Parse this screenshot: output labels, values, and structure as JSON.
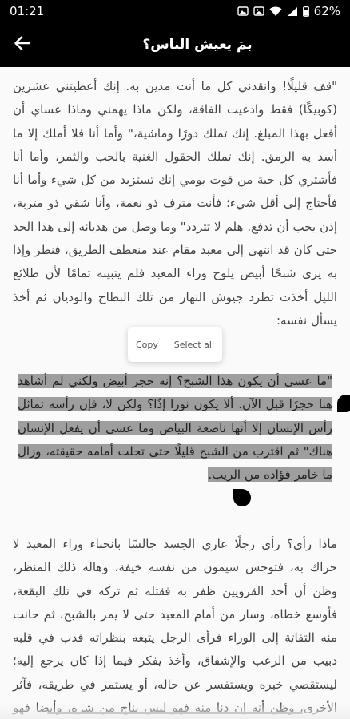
{
  "status": {
    "time": "01:21",
    "battery": "62%",
    "icons": [
      "photo-icon",
      "image-icon",
      "wifi-icon",
      "signal-icon"
    ]
  },
  "appbar": {
    "title": "بمَ يعيش الناس؟",
    "back_icon": "arrow-left-icon"
  },
  "paragraphs": {
    "p1": "\"قف قليلًا! وانقدني كل ما أنت مدين به. إنك أعطيتني عشرين (كوبيكًا) فقط وادعيت الفاقة، ولكن ماذا يهمني وماذا عساي أن أفعل بهذا المبلغ. إنك تملك دورًا وماشية،\" وأما أنا فلا أملك إلا ما أسد به الرمق. إنك تملك الحقول الغنية بالحب والثمر، وأما أنا فأشتري كل حبة من قوت يومي إنك تستزيد من كل شيء وأما أنا فأحتاج إلى أقل شيء؛ فأنت مترف ذو نعمة، وأنا شقي ذو متربة، إذن يجب أن تدفع. هلم لا تتردد\" وما وصل من هذيانه إلى هذا الحد حتى كان قد انتهى إلى معبد مقام عند منعطف الطريق، فنظر وإذا به يرى شبحًا أبيض يلوح وراء المعبد فلم يتبينه تمامًا لأن طلائع الليل أخذت تطرد جيوش النهار من تلك البطاح والوديان ثم أخذ يسأل نفسه:",
    "p2": "\"ما عسى أن يكون هذا الشبح؟ إنه حجر أبيض ولكني لم أشاهد هنا حجرًا قبل الآن. ألا يكون نورا إذًا؟ ولكن لا، فإن رأسه تماثل رأس الإنسان إلا أنها ناصعة البياض وما عسى أن يفعل الإنسان هناك\" ثم اقترب من الشبح قليلًا حتى تجلت أمامه حقيقته، وزال ما خامر فؤاده من الريب.",
    "p3": "ماذا رأى؟ رأى رجلًا عاري الجسد جالسًا بانحناء وراء المعبد لا حراك به، فتوجس سيمون من نفسه خيفة، وهاله ذلك المنظر، وظن أن أحد القرويين ظفر به فقتله ثم تركه في تلك البقعة، فأوسع خطاه، وسار من أمام المعبد حتى لا يمر بالشبح، ثم حانت منه التفاتة إلى الوراء فرأى الرجل يتبعه بنظراته فدب في قلبه دبيب من الرعب والإشفاق، وأخذ يفكر فيما إذا كان يرجع إليه؛ ليستقصي خبره ويستفسر عن حاله، أو يستمر في طريقه، فآثر الأخرى، وظن أنه إن دنا منه فهو ليس بناج من شره، وأيضا فهو غير قادر على إعانة"
  },
  "selection_popup": {
    "copy_label": "Copy",
    "select_all_label": "Select all"
  }
}
